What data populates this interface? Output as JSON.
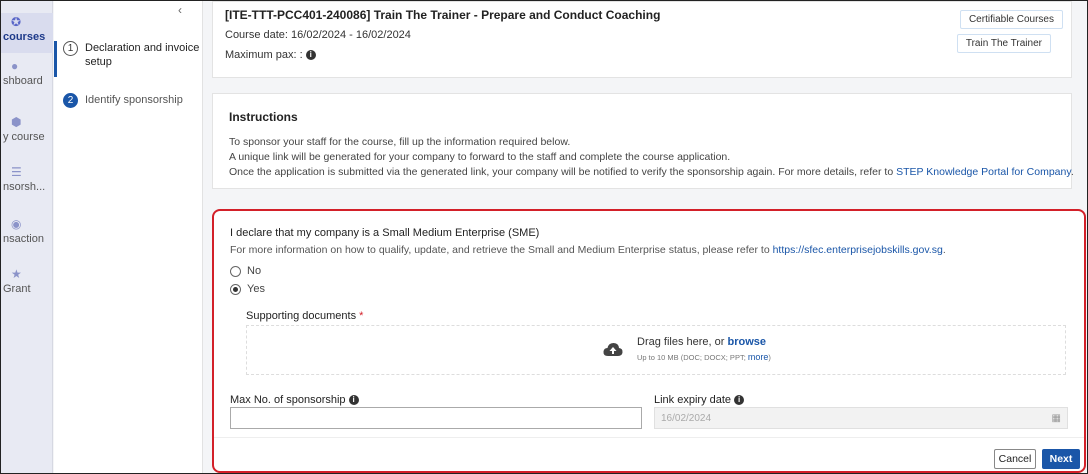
{
  "rail": {
    "items": [
      {
        "label": "courses",
        "icon": "home-icon",
        "active": true
      },
      {
        "label": "shboard",
        "icon": "dashboard-icon"
      },
      {
        "label": "y course",
        "icon": "course-icon"
      },
      {
        "label": "nsorsh...",
        "icon": "list-icon"
      },
      {
        "label": "nsaction",
        "icon": "transaction-icon"
      },
      {
        "label": "Grant",
        "icon": "trophy-icon"
      }
    ]
  },
  "steps": {
    "collapse_glyph": "‹",
    "items": [
      {
        "number": "1",
        "label": "Declaration and invoice setup"
      },
      {
        "number": "2",
        "label": "Identify sponsorship"
      }
    ]
  },
  "course": {
    "title": "[ITE-TTT-PCC401-240086] Train The Trainer - Prepare and Conduct Coaching",
    "date": "Course date: 16/02/2024 - 16/02/2024",
    "pax": "Maximum pax: :",
    "tags": [
      "Certifiable Courses",
      "Train The Trainer"
    ]
  },
  "instructions": {
    "title": "Instructions",
    "line1": "To sponsor your staff for the course, fill up the information required below.",
    "line2": "A unique link will be generated for your company to forward to the staff and complete the course application.",
    "line3": "Once the application is submitted via the generated link, your company will be notified to verify the sponsorship again. For more details, refer to ",
    "line3_link": "STEP Knowledge Portal for Company",
    "line3_end": "."
  },
  "form": {
    "sme_question": "I declare that my company is a Small Medium Enterprise (SME)",
    "sme_info": "For more information on how to qualify, update, and retrieve the Small and Medium Enterprise status, please refer to ",
    "sme_link": "https://sfec.enterprisejobskills.gov.sg",
    "sme_info_end": ".",
    "options": [
      "No",
      "Yes"
    ],
    "selected": "Yes",
    "docs_label": "Supporting documents",
    "required_mark": "*",
    "drop_text": "Drag files here, or ",
    "browse_label": "browse",
    "drop_sub": "Up to 10 MB (DOC; DOCX; PPT; ",
    "more_label": "more",
    "drop_sub_end": ")",
    "max_label": "Max No. of sponsorship",
    "max_value": "",
    "expiry_label": "Link expiry date",
    "expiry_value": "16/02/2024",
    "cancel_label": "Cancel",
    "next_label": "Next"
  },
  "colors": {
    "accent": "#1a56a8",
    "highlight": "#d32029"
  }
}
